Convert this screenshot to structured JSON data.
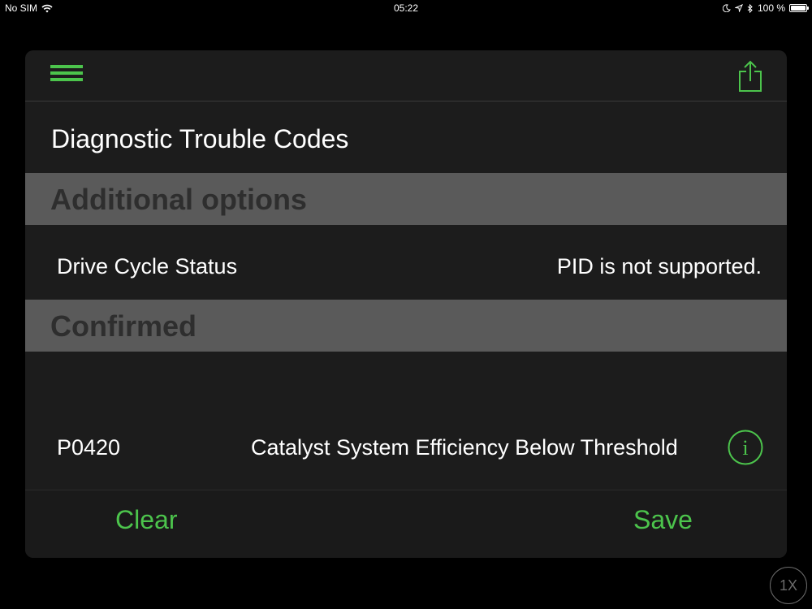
{
  "status_bar": {
    "carrier": "No SIM",
    "time": "05:22",
    "battery": "100 %",
    "icons": [
      "wifi-icon",
      "moon-icon",
      "location-icon",
      "bluetooth-icon",
      "battery-icon"
    ]
  },
  "toolbar": {
    "menu_icon": "hamburger-menu-icon",
    "share_icon": "share-icon",
    "accent_color": "#4cc44c"
  },
  "page": {
    "title": "Diagnostic Trouble Codes"
  },
  "sections": [
    {
      "header": "Additional options",
      "rows": [
        {
          "label": "Drive Cycle Status",
          "value": "PID is not supported."
        }
      ]
    },
    {
      "header": "Confirmed",
      "rows": [
        {
          "code": "P0420",
          "description": "Catalyst System Efficiency Below Threshold",
          "icon": "info-icon"
        }
      ]
    }
  ],
  "bottom_bar": {
    "clear_label": "Clear",
    "save_label": "Save"
  },
  "zoom_badge": "1X"
}
